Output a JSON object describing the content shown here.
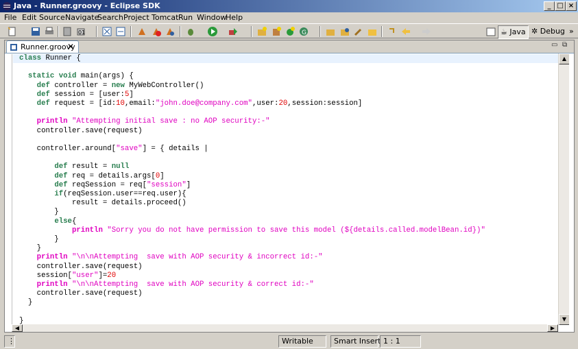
{
  "window": {
    "title": "Java - Runner.groovy - Eclipse SDK",
    "buttons": {
      "minimize": "_",
      "maximize": "□",
      "close": "×"
    }
  },
  "menu": [
    {
      "label": "File"
    },
    {
      "label": "Edit"
    },
    {
      "label": "Source"
    },
    {
      "label": "Navigate"
    },
    {
      "label": "Search"
    },
    {
      "label": "Project"
    },
    {
      "label": "Tomcat"
    },
    {
      "label": "Run"
    },
    {
      "label": "Window"
    },
    {
      "label": "Help"
    }
  ],
  "perspectives": {
    "java": "Java",
    "debug": "Debug",
    "more": "»"
  },
  "editor": {
    "tab_title": "Runner.groovy",
    "tab_close": "✕",
    "code_lines": [
      "class Runner {",
      "",
      "  static void main(args) {",
      "    def controller = new MyWebController()",
      "    def session = [user:5]",
      "    def request = [id:10,email:\"john.doe@company.com\",user:20,session:session]",
      "",
      "    println \"Attempting initial save : no AOP security:-\"",
      "    controller.save(request)",
      "",
      "    controller.around[\"save\"] = { details |",
      "",
      "        def result = null",
      "        def req = details.args[0]",
      "        def reqSession = req[\"session\"]",
      "        if(reqSession.user==req.user){",
      "            result = details.proceed()",
      "        }",
      "        else{",
      "            println \"Sorry you do not have permission to save this model (${details.called.modelBean.id})\"",
      "        }",
      "    }",
      "    println \"\\n\\nAttempting  save with AOP security & incorrect id:-\"",
      "    controller.save(request)",
      "    session[\"user\"]=20",
      "    println \"\\n\\nAttempting  save with AOP security & correct id:-\"",
      "    controller.save(request)",
      "  }",
      "",
      "}"
    ]
  },
  "status": {
    "writable": "Writable",
    "insert_mode": "Smart Insert",
    "position": "1 : 1"
  },
  "colors": {
    "keyword": "#2a7f50",
    "string": "#e000c0",
    "number": "#e00000",
    "title_gradient_start": "#0a246a"
  }
}
